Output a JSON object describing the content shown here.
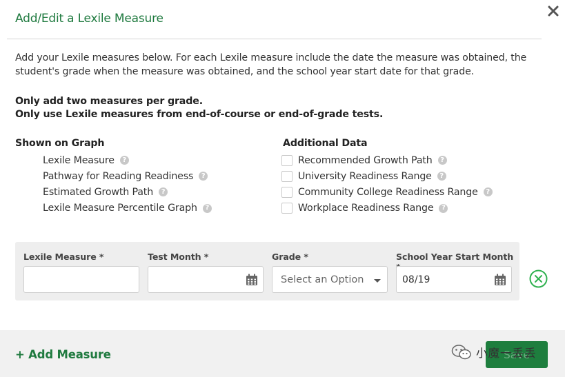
{
  "modal": {
    "title": "Add/Edit a Lexile Measure",
    "close_icon": "close-icon"
  },
  "intro": {
    "text": "Add your Lexile measures below. For each Lexile measure include the date the measure was obtained, the student's grade when the measure was obtained, and the school year start date for that grade.",
    "rule_1": "Only add two measures per grade.",
    "rule_2": "Only use Lexile measures from end-of-course or end-of-grade tests."
  },
  "shown_on_graph": {
    "heading": "Shown on Graph",
    "items": [
      {
        "label": "Lexile Measure"
      },
      {
        "label": "Pathway for Reading Readiness"
      },
      {
        "label": "Estimated Growth Path"
      },
      {
        "label": "Lexile Measure Percentile Graph"
      }
    ]
  },
  "additional_data": {
    "heading": "Additional Data",
    "items": [
      {
        "label": "Recommended Growth Path",
        "checked": false
      },
      {
        "label": "University Readiness Range",
        "checked": false
      },
      {
        "label": "Community College Readiness Range",
        "checked": false
      },
      {
        "label": "Workplace Readiness Range",
        "checked": false
      }
    ]
  },
  "help_glyph": "?",
  "entry": {
    "lexile_label": "Lexile Measure *",
    "lexile_value": "",
    "test_month_label": "Test Month *",
    "test_month_value": "",
    "grade_label": "Grade *",
    "grade_placeholder": "Select an Option",
    "school_year_label": "School Year Start Month *",
    "school_year_value": "08/19"
  },
  "footer": {
    "add_measure": "+ Add Measure",
    "watermark_text": "小魔一丢丢",
    "save_label": "Save"
  },
  "colors": {
    "accent_green": "#1f7a3f",
    "button_green": "#1e7e3e",
    "remove_green": "#2fb14f",
    "help_gray": "#c8c8c8"
  }
}
